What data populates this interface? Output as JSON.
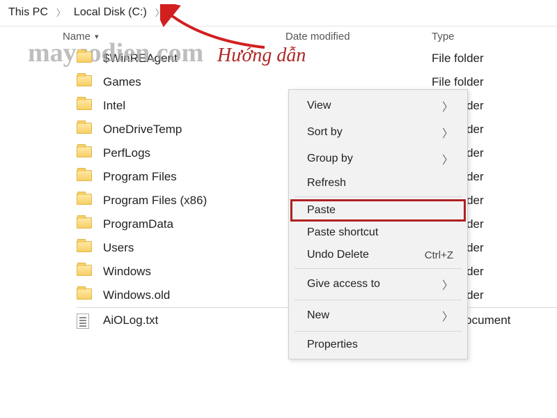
{
  "breadcrumb": {
    "root": "This PC",
    "drive": "Local Disk (C:)"
  },
  "columns": {
    "name": "Name",
    "date": "Date modified",
    "type": "Type"
  },
  "watermark": "maycodien.com",
  "overlay_title": "Hướng dẫn",
  "type_labels": {
    "folder": "File folder",
    "txt": "Text Document"
  },
  "files": [
    {
      "name": "$WinREAgent",
      "kind": "folder"
    },
    {
      "name": "Games",
      "kind": "folder"
    },
    {
      "name": "Intel",
      "kind": "folder"
    },
    {
      "name": "OneDriveTemp",
      "kind": "folder"
    },
    {
      "name": "PerfLogs",
      "kind": "folder"
    },
    {
      "name": "Program Files",
      "kind": "folder"
    },
    {
      "name": "Program Files (x86)",
      "kind": "folder"
    },
    {
      "name": "ProgramData",
      "kind": "folder"
    },
    {
      "name": "Users",
      "kind": "folder"
    },
    {
      "name": "Windows",
      "kind": "folder"
    },
    {
      "name": "Windows.old",
      "kind": "folder"
    },
    {
      "name": "AiOLog.txt",
      "kind": "txt"
    }
  ],
  "context_menu": {
    "view": "View",
    "sort_by": "Sort by",
    "group_by": "Group by",
    "refresh": "Refresh",
    "paste": "Paste",
    "paste_shortcut": "Paste shortcut",
    "undo_delete": "Undo Delete",
    "undo_shortcut": "Ctrl+Z",
    "give_access": "Give access to",
    "new": "New",
    "properties": "Properties"
  }
}
